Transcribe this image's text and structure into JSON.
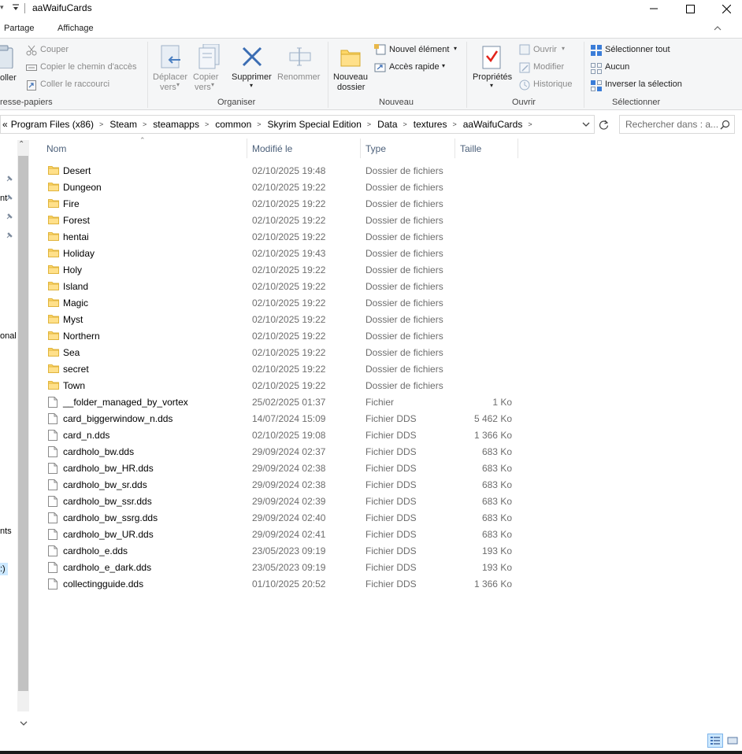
{
  "window": {
    "title": "aaWaifuCards"
  },
  "ribbon_tabs": [
    "Partage",
    "Affichage"
  ],
  "ribbon": {
    "clipboard": {
      "paste_partial": "oller",
      "cut": "Couper",
      "copy_path": "Copier le chemin d'accès",
      "paste_shortcut": "Coller le raccourci",
      "group_label": "resse-papiers"
    },
    "organize": {
      "move_line1": "Déplacer",
      "move_line2": "vers",
      "copy_line1": "Copier",
      "copy_line2": "vers",
      "delete": "Supprimer",
      "rename": "Renommer",
      "group_label": "Organiser"
    },
    "new": {
      "new_folder_line1": "Nouveau",
      "new_folder_line2": "dossier",
      "new_item": "Nouvel élément",
      "easy_access": "Accès rapide",
      "group_label": "Nouveau"
    },
    "open": {
      "properties": "Propriétés",
      "open": "Ouvrir",
      "edit": "Modifier",
      "history": "Historique",
      "group_label": "Ouvrir"
    },
    "select": {
      "select_all": "Sélectionner tout",
      "select_none": "Aucun",
      "invert": "Inverser la sélection",
      "group_label": "Sélectionner"
    }
  },
  "address": {
    "overflow": "«",
    "crumbs": [
      "Program Files (x86)",
      "Steam",
      "steamapps",
      "common",
      "Skyrim Special Edition",
      "Data",
      "textures",
      "aaWaifuCards"
    ]
  },
  "search": {
    "placeholder": "Rechercher dans : a..."
  },
  "nav": {
    "fragments": [
      "nt",
      "onal",
      "nts",
      ":)"
    ]
  },
  "columns": {
    "name": "Nom",
    "modified": "Modifié le",
    "type": "Type",
    "size": "Taille"
  },
  "files": [
    {
      "name": "Desert",
      "modified": "02/10/2025 19:48",
      "type": "Dossier de fichiers",
      "size": "",
      "kind": "folder"
    },
    {
      "name": "Dungeon",
      "modified": "02/10/2025 19:22",
      "type": "Dossier de fichiers",
      "size": "",
      "kind": "folder"
    },
    {
      "name": "Fire",
      "modified": "02/10/2025 19:22",
      "type": "Dossier de fichiers",
      "size": "",
      "kind": "folder"
    },
    {
      "name": "Forest",
      "modified": "02/10/2025 19:22",
      "type": "Dossier de fichiers",
      "size": "",
      "kind": "folder"
    },
    {
      "name": "hentai",
      "modified": "02/10/2025 19:22",
      "type": "Dossier de fichiers",
      "size": "",
      "kind": "folder"
    },
    {
      "name": "Holiday",
      "modified": "02/10/2025 19:43",
      "type": "Dossier de fichiers",
      "size": "",
      "kind": "folder"
    },
    {
      "name": "Holy",
      "modified": "02/10/2025 19:22",
      "type": "Dossier de fichiers",
      "size": "",
      "kind": "folder"
    },
    {
      "name": "Island",
      "modified": "02/10/2025 19:22",
      "type": "Dossier de fichiers",
      "size": "",
      "kind": "folder"
    },
    {
      "name": "Magic",
      "modified": "02/10/2025 19:22",
      "type": "Dossier de fichiers",
      "size": "",
      "kind": "folder"
    },
    {
      "name": "Myst",
      "modified": "02/10/2025 19:22",
      "type": "Dossier de fichiers",
      "size": "",
      "kind": "folder"
    },
    {
      "name": "Northern",
      "modified": "02/10/2025 19:22",
      "type": "Dossier de fichiers",
      "size": "",
      "kind": "folder"
    },
    {
      "name": "Sea",
      "modified": "02/10/2025 19:22",
      "type": "Dossier de fichiers",
      "size": "",
      "kind": "folder"
    },
    {
      "name": "secret",
      "modified": "02/10/2025 19:22",
      "type": "Dossier de fichiers",
      "size": "",
      "kind": "folder"
    },
    {
      "name": "Town",
      "modified": "02/10/2025 19:22",
      "type": "Dossier de fichiers",
      "size": "",
      "kind": "folder"
    },
    {
      "name": "__folder_managed_by_vortex",
      "modified": "25/02/2025 01:37",
      "type": "Fichier",
      "size": "1 Ko",
      "kind": "file"
    },
    {
      "name": "card_biggerwindow_n.dds",
      "modified": "14/07/2024 15:09",
      "type": "Fichier DDS",
      "size": "5 462 Ko",
      "kind": "file"
    },
    {
      "name": "card_n.dds",
      "modified": "02/10/2025 19:08",
      "type": "Fichier DDS",
      "size": "1 366 Ko",
      "kind": "file"
    },
    {
      "name": "cardholo_bw.dds",
      "modified": "29/09/2024 02:37",
      "type": "Fichier DDS",
      "size": "683 Ko",
      "kind": "file"
    },
    {
      "name": "cardholo_bw_HR.dds",
      "modified": "29/09/2024 02:38",
      "type": "Fichier DDS",
      "size": "683 Ko",
      "kind": "file"
    },
    {
      "name": "cardholo_bw_sr.dds",
      "modified": "29/09/2024 02:38",
      "type": "Fichier DDS",
      "size": "683 Ko",
      "kind": "file"
    },
    {
      "name": "cardholo_bw_ssr.dds",
      "modified": "29/09/2024 02:39",
      "type": "Fichier DDS",
      "size": "683 Ko",
      "kind": "file"
    },
    {
      "name": "cardholo_bw_ssrg.dds",
      "modified": "29/09/2024 02:40",
      "type": "Fichier DDS",
      "size": "683 Ko",
      "kind": "file"
    },
    {
      "name": "cardholo_bw_UR.dds",
      "modified": "29/09/2024 02:41",
      "type": "Fichier DDS",
      "size": "683 Ko",
      "kind": "file"
    },
    {
      "name": "cardholo_e.dds",
      "modified": "23/05/2023 09:19",
      "type": "Fichier DDS",
      "size": "193 Ko",
      "kind": "file"
    },
    {
      "name": "cardholo_e_dark.dds",
      "modified": "23/05/2023 09:19",
      "type": "Fichier DDS",
      "size": "193 Ko",
      "kind": "file"
    },
    {
      "name": "collectingguide.dds",
      "modified": "01/10/2025 20:52",
      "type": "Fichier DDS",
      "size": "1 366 Ko",
      "kind": "file"
    }
  ],
  "icons": {
    "folder": "folder-icon",
    "file": "file-icon"
  },
  "colors": {
    "accent": "#0067c0",
    "folder": "#ffd769",
    "header_text": "#4c607a",
    "meta_text": "#6d6d6d",
    "selection": "#cce8ff"
  }
}
